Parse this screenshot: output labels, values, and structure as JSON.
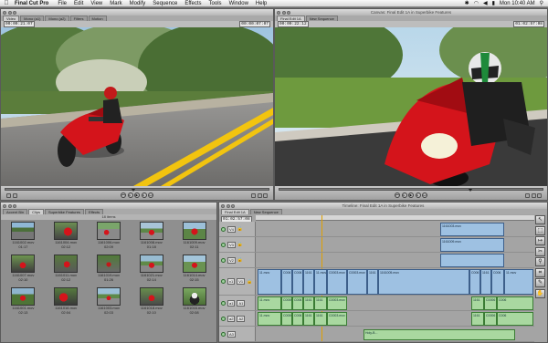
{
  "menubar": {
    "app": "Final Cut Pro",
    "items": [
      "File",
      "Edit",
      "View",
      "Mark",
      "Modify",
      "Sequence",
      "Effects",
      "Tools",
      "Window",
      "Help"
    ],
    "clock": "Mon 10:40 AM"
  },
  "viewer": {
    "tabs": [
      "Video",
      "Mono (a1)",
      "Mono (a2)",
      "Filters",
      "Motion"
    ],
    "timecode_left": "00:00:21:07",
    "timecode_right": "00:00:07:07"
  },
  "canvas": {
    "title": "Canvas: Final Edit 1A in Superbike Features",
    "tabs": [
      "Final Edit 1A",
      "New Sequence"
    ],
    "timecode_left": "00:00:22:12",
    "timecode_right": "01:02:57:08"
  },
  "browser": {
    "tabs": [
      "Accent Bin",
      "Clips",
      "Superbike Features",
      "Effects"
    ],
    "count": "18 items",
    "clips": [
      {
        "name": "1161002.mov",
        "dur": "01:17"
      },
      {
        "name": "1161004.mov",
        "dur": "02:12"
      },
      {
        "name": "1161006.mov",
        "dur": "02:09"
      },
      {
        "name": "1161008.mov",
        "dur": "01:18"
      },
      {
        "name": "1161009.mov",
        "dur": "02:11"
      },
      {
        "name": "1161007.mov",
        "dur": "02:10"
      },
      {
        "name": "1161011.mov",
        "dur": "02:12"
      },
      {
        "name": "1161019.mov",
        "dur": "01:26"
      },
      {
        "name": "1161021.mov",
        "dur": "02:14"
      },
      {
        "name": "1161014.mov",
        "dur": "02:15"
      },
      {
        "name": "1161001.mov",
        "dur": "02:13"
      },
      {
        "name": "1161016.mov",
        "dur": "02:04"
      },
      {
        "name": "1161003.mov",
        "dur": "02:03"
      },
      {
        "name": "1161018.mov",
        "dur": "02:10"
      },
      {
        "name": "1161016.mov",
        "dur": "02:08"
      }
    ]
  },
  "timeline": {
    "title": "Timeline: Final Edit 1A in Superbike Features",
    "tabs": [
      "Final Edit 1A",
      "New Sequence"
    ],
    "timecode": "01:02:57:08",
    "tracks": [
      {
        "label": "V4"
      },
      {
        "label": "V3"
      },
      {
        "label": "V2"
      },
      {
        "label": "v1",
        "target": "V1"
      },
      {
        "label": "a1",
        "target": "A1"
      },
      {
        "label": "a2",
        "target": "A2"
      },
      {
        "label": "A3"
      }
    ],
    "clip_labels": {
      "v4": "1161003.mov",
      "v3": "1161009.mov",
      "v1": [
        "11.mov",
        "C006",
        "C006",
        "1161",
        "11.mov",
        "C0003.mov",
        "C0003.mov",
        "1161",
        "1161005.mov",
        "C006",
        "1161",
        "C006",
        "11.mov"
      ],
      "a1": [
        "11.mov",
        "C0006",
        "C006",
        "1161",
        "1161",
        "C0003.mov",
        "1161",
        "C0006",
        "C006"
      ],
      "a2": [
        "11.mov",
        "C0006",
        "C006",
        "1161",
        "1161",
        "C0003.mov",
        "1161",
        "C0006",
        "C006"
      ],
      "a3": "Holy-B..."
    }
  },
  "tools": [
    "arrow",
    "select",
    "track",
    "razor",
    "zoom",
    "crop",
    "pen",
    "hand"
  ],
  "colors": {
    "video_clip": "#9ec1e2",
    "audio_clip": "#a9d8a0",
    "bike_red": "#d4141b"
  }
}
